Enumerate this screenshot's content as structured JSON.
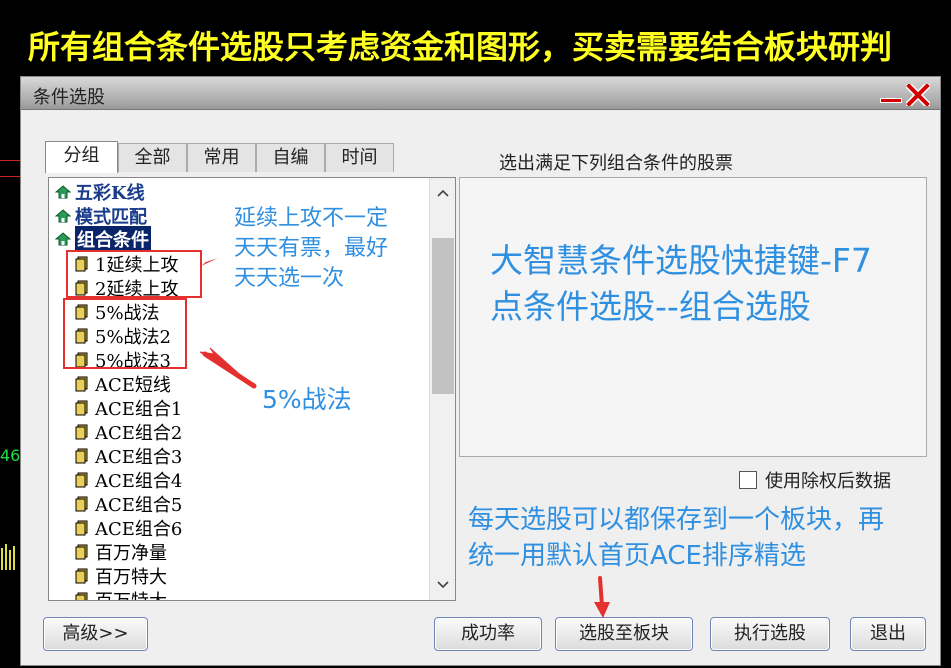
{
  "banner": {
    "text": "所有组合条件选股只考虑资金和图形，买卖需要结合板块研判"
  },
  "background": {
    "left_number": "46"
  },
  "dialog": {
    "title": "条件选股",
    "tabs": [
      {
        "label": "分组",
        "active": true
      },
      {
        "label": "全部",
        "active": false
      },
      {
        "label": "常用",
        "active": false
      },
      {
        "label": "自编",
        "active": false
      },
      {
        "label": "时间",
        "active": false
      }
    ],
    "tree": {
      "groups": [
        {
          "label": "五彩K线",
          "icon": "home-icon"
        },
        {
          "label": "模式匹配",
          "icon": "home-icon"
        },
        {
          "label": "组合条件",
          "icon": "home-icon",
          "selected": true
        }
      ],
      "items": [
        "1延续上攻",
        "2延续上攻",
        "5%战法",
        "5%战法2",
        "5%战法3",
        "ACE短线",
        "ACE组合1",
        "ACE组合2",
        "ACE组合3",
        "ACE组合4",
        "ACE组合5",
        "ACE组合6",
        "百万净量",
        "百万特大",
        "百万特大"
      ]
    },
    "result_title": "选出满足下列组合条件的股票",
    "checkbox_label": "使用除权后数据",
    "buttons": {
      "advanced": "高级>>",
      "success_rate": "成功率",
      "save_to_block": "选股至板块",
      "execute": "执行选股",
      "exit": "退出"
    }
  },
  "annotations": {
    "note1": [
      "延续上攻不一定",
      "天天有票，最好",
      "天天选一次"
    ],
    "note2": "5%战法",
    "note3": [
      "大智慧条件选股快捷键-F7",
      "点条件选股--组合选股"
    ],
    "note4": [
      "每天选股可以都保存到一个板块，再",
      "统一用默认首页ACE排序精选"
    ]
  },
  "colors": {
    "annotation": "#2f8fe0",
    "banner": "#ffff22",
    "highlight_box": "#e53030"
  }
}
